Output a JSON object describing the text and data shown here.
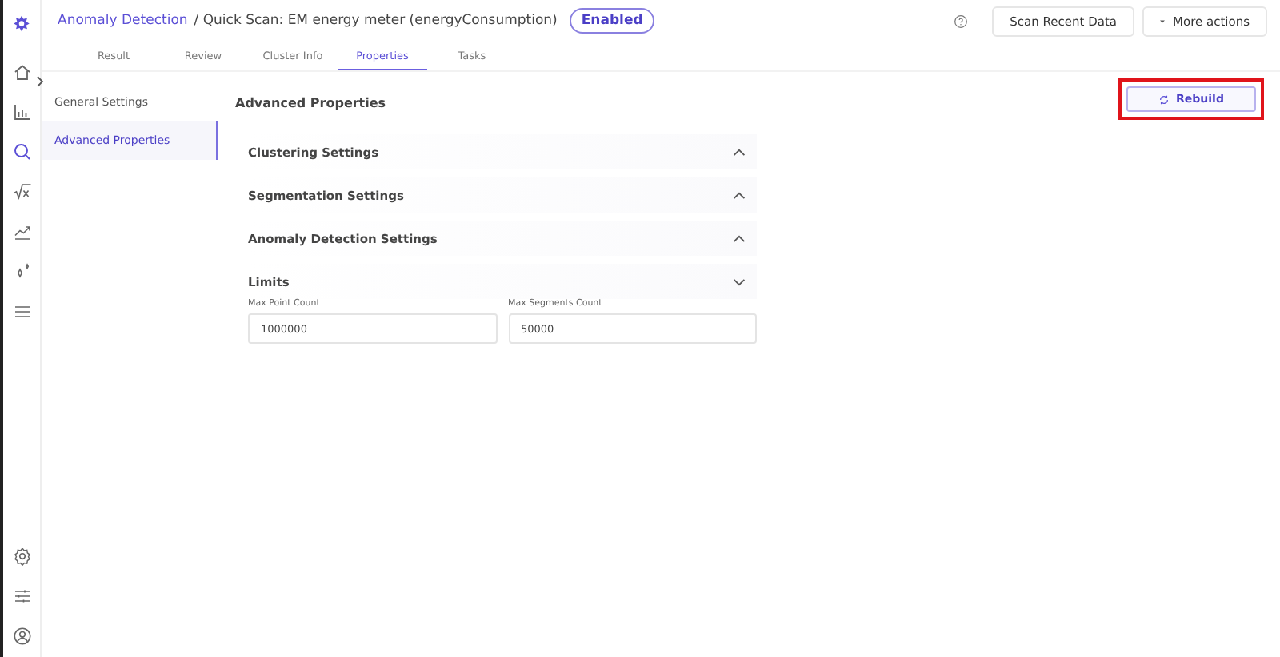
{
  "breadcrumb": {
    "link": "Anomaly Detection",
    "title": "/ Quick Scan: EM energy meter (energyConsumption)",
    "status": "Enabled"
  },
  "header_buttons": [
    "Scan Recent Data",
    "More actions"
  ],
  "tabs": [
    {
      "label": "Result",
      "selected": false
    },
    {
      "label": "Review",
      "selected": false
    },
    {
      "label": "Cluster Info",
      "selected": false
    },
    {
      "label": "Properties",
      "selected": true
    },
    {
      "label": "Tasks",
      "selected": false
    }
  ],
  "side_menu": [
    {
      "label": "General Settings",
      "selected": false
    },
    {
      "label": "Advanced Properties",
      "selected": true
    }
  ],
  "panel": {
    "title": "Advanced Properties",
    "action": "Rebuild",
    "sections": [
      {
        "title": "Clustering Settings",
        "expanded": false
      },
      {
        "title": "Segmentation Settings",
        "expanded": false
      },
      {
        "title": "Anomaly Detection Settings",
        "expanded": false
      },
      {
        "title": "Limits",
        "expanded": true,
        "fields": [
          {
            "label": "Max Point Count",
            "value": "1000000"
          },
          {
            "label": "Max Segments Count",
            "value": "50000"
          }
        ]
      }
    ]
  }
}
